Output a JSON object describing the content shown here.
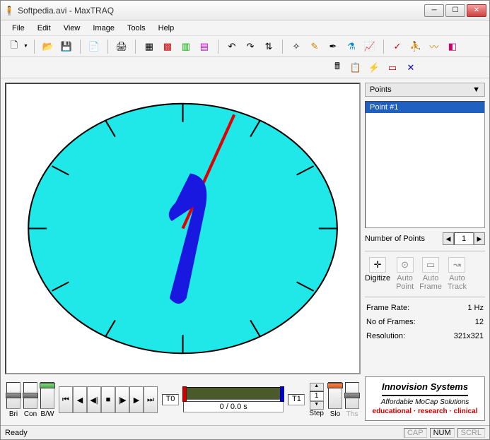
{
  "title": "Softpedia.avi - MaxTRAQ",
  "menus": [
    "File",
    "Edit",
    "View",
    "Image",
    "Tools",
    "Help"
  ],
  "toolbar1": {
    "new": "🗋",
    "open": "📂",
    "save": "💾",
    "copy": "📄",
    "print": "🖨",
    "grid1": "▦",
    "grid2": "▩",
    "grid3": "▥",
    "grid4": "▤",
    "rotl": "↶",
    "rotr": "↷",
    "flip": "⇅",
    "wand": "✧",
    "pencil": "✎",
    "compass": "✒",
    "micro": "⚗",
    "plot": "📈",
    "fig1": "✓",
    "fig2": "⛹",
    "wave": "〰",
    "erase": "◧"
  },
  "toolbar2": {
    "calc": "🖩",
    "eq": "📋",
    "bolt": "⚡",
    "rect": "▭",
    "cross": "✕"
  },
  "transport": {
    "bri": "Bri",
    "con": "Con",
    "bw": "B/W",
    "first": "⏮",
    "prev": "◀",
    "stepback": "◀|",
    "stop": "■",
    "stepfwd": "|▶",
    "next": "▶",
    "last": "⏭",
    "t0": "T0",
    "t1": "T1",
    "time": "0 /  0.0 s",
    "step_up": "▲",
    "step_dn": "▼",
    "step_val": "1",
    "step": "Step",
    "slo": "Slo",
    "ths": "Ths"
  },
  "side": {
    "points_label": "Points",
    "point_items": [
      "Point #1"
    ],
    "num_points_label": "Number of Points",
    "num_points_val": "1",
    "digitize": "Digitize",
    "auto_point": "Auto\nPoint",
    "auto_frame": "Auto\nFrame",
    "auto_track": "Auto\nTrack",
    "frame_rate_lbl": "Frame Rate:",
    "frame_rate_val": "1 Hz",
    "no_frames_lbl": "No of Frames:",
    "no_frames_val": "12",
    "resolution_lbl": "Resolution:",
    "resolution_val": "321x321"
  },
  "logo": {
    "brand": "Innovision Systems",
    "sub": "Affordable MoCap Solutions",
    "tags": "educational · research · clinical"
  },
  "status": {
    "ready": "Ready",
    "cap": "CAP",
    "num": "NUM",
    "scrl": "SCRL"
  }
}
